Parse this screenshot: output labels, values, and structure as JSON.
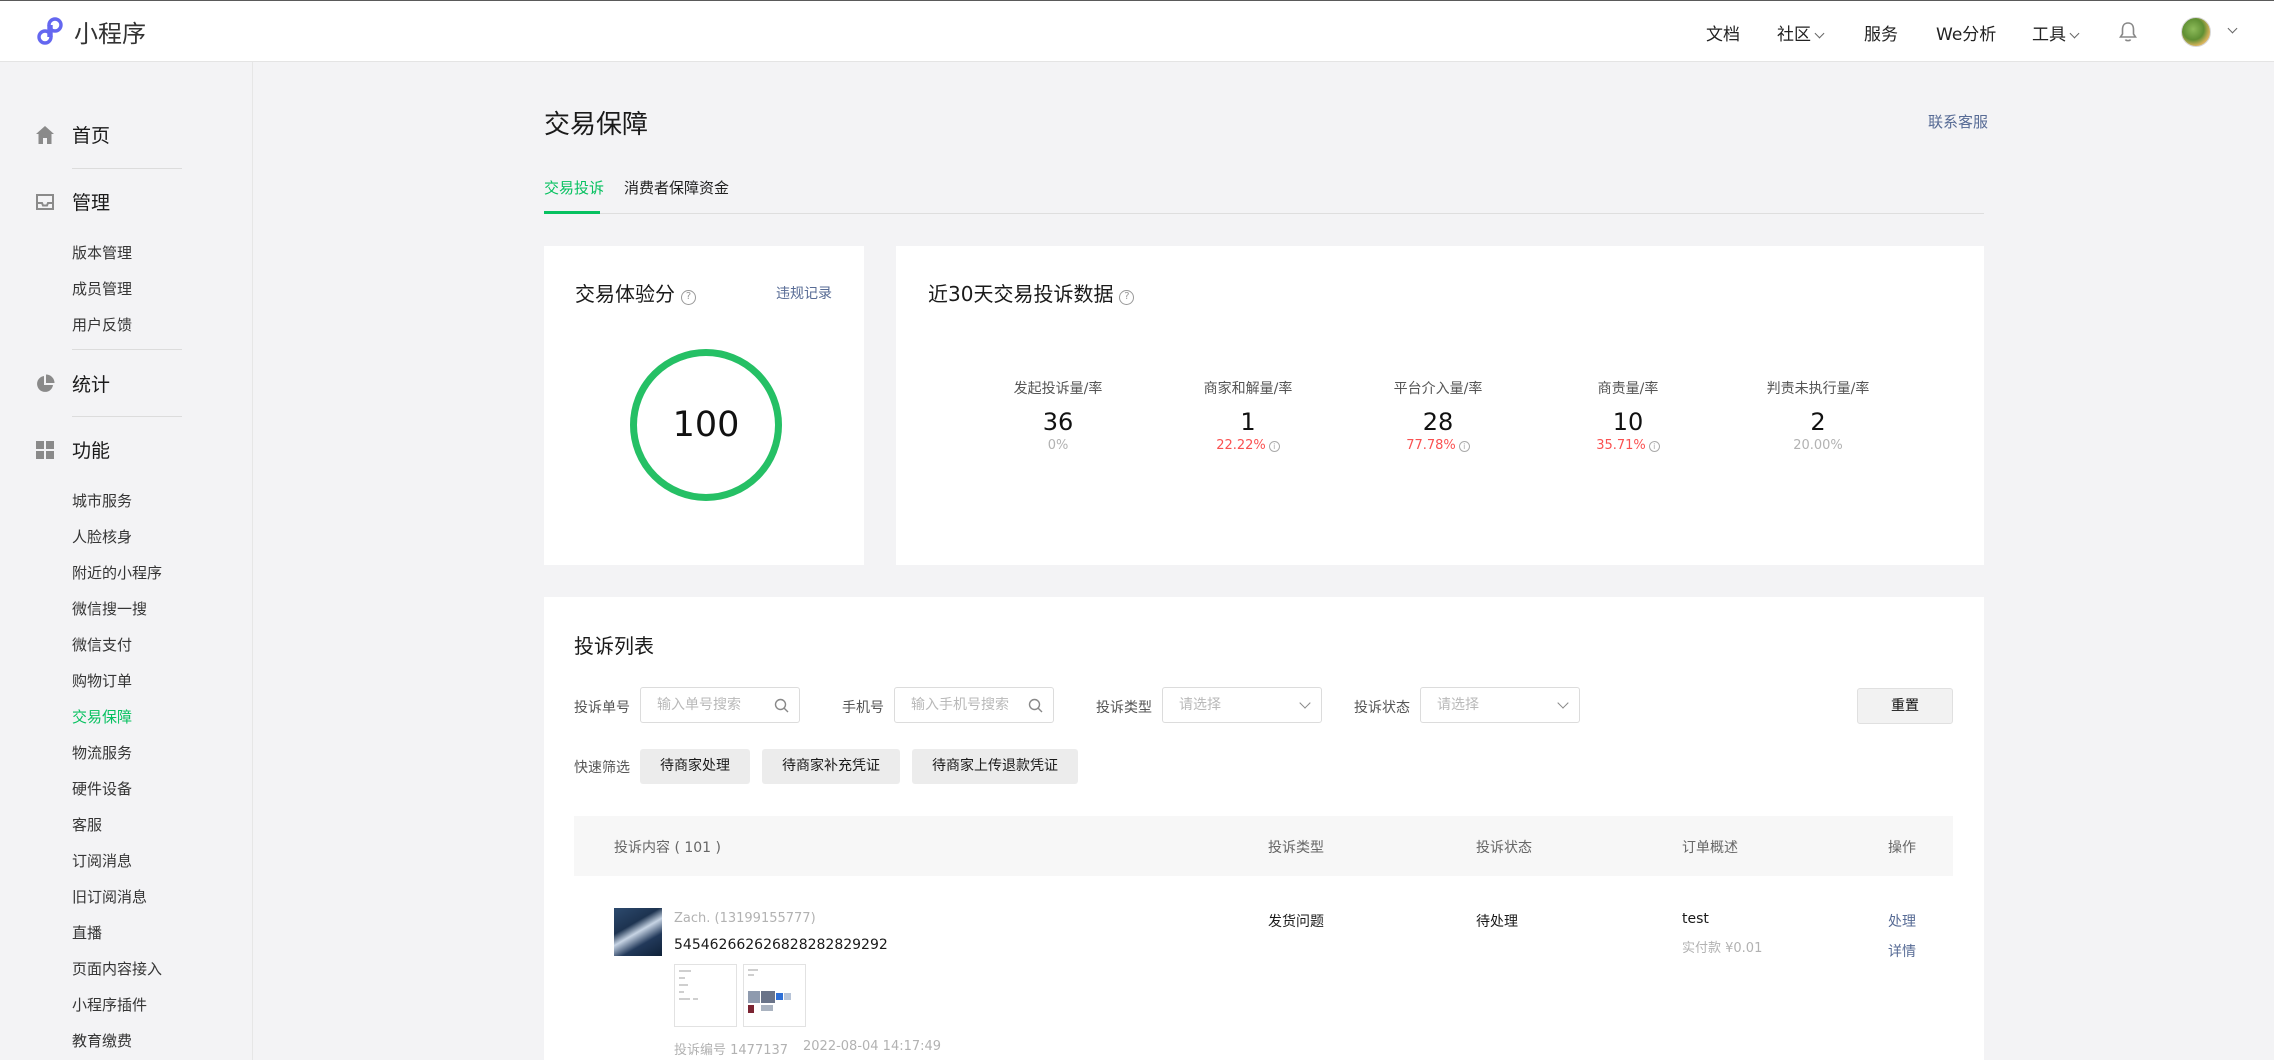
{
  "brand": {
    "name": "小程序"
  },
  "topnav": {
    "docs": "文档",
    "community": "社区",
    "service": "服务",
    "analytics": "We分析",
    "tools": "工具"
  },
  "sidebar": {
    "home": "首页",
    "manage": "管理",
    "manage_items": [
      "版本管理",
      "成员管理",
      "用户反馈"
    ],
    "stats": "统计",
    "features": "功能",
    "feature_items": [
      "城市服务",
      "人脸核身",
      "附近的小程序",
      "微信搜一搜",
      "微信支付",
      "购物订单",
      "交易保障",
      "物流服务",
      "硬件设备",
      "客服",
      "订阅消息",
      "旧订阅消息",
      "直播",
      "页面内容接入",
      "小程序插件",
      "教育缴费"
    ],
    "active_item": "交易保障"
  },
  "page": {
    "title": "交易保障",
    "contact": "联系客服",
    "tabs": [
      "交易投诉",
      "消费者保障资金"
    ],
    "active_tab": "交易投诉"
  },
  "score_card": {
    "title": "交易体验分",
    "violation_link": "违规记录",
    "score": "100",
    "ring_fill_fraction": 1.0,
    "ring_color": "#25c065"
  },
  "stats_card": {
    "title": "近30天交易投诉数据",
    "items": [
      {
        "label": "发起投诉量/率",
        "value": "36",
        "rate": "0%",
        "rate_color": "#b2b2b2",
        "info": false
      },
      {
        "label": "商家和解量/率",
        "value": "1",
        "rate": "22.22%",
        "rate_color": "#fa5151",
        "info": true
      },
      {
        "label": "平台介入量/率",
        "value": "28",
        "rate": "77.78%",
        "rate_color": "#fa5151",
        "info": true
      },
      {
        "label": "商责量/率",
        "value": "10",
        "rate": "35.71%",
        "rate_color": "#fa5151",
        "info": true
      },
      {
        "label": "判责未执行量/率",
        "value": "2",
        "rate": "20.00%",
        "rate_color": "#b2b2b2",
        "info": false
      }
    ]
  },
  "complaints": {
    "title": "投诉列表",
    "filters": {
      "order_label": "投诉单号",
      "order_placeholder": "输入单号搜索",
      "phone_label": "手机号",
      "phone_placeholder": "输入手机号搜索",
      "type_label": "投诉类型",
      "type_placeholder": "请选择",
      "status_label": "投诉状态",
      "status_placeholder": "请选择",
      "reset": "重置"
    },
    "quick_filter_label": "快速筛选",
    "quick_filters": [
      "待商家处理",
      "待商家补充凭证",
      "待商家上传退款凭证"
    ],
    "table": {
      "columns": [
        "投诉内容 ( 101 )",
        "投诉类型",
        "投诉状态",
        "订单概述",
        "操作"
      ],
      "rows": [
        {
          "user": "Zach. (13199155777)",
          "order_no": "545462662626828282829292",
          "type": "发货问题",
          "status": "待处理",
          "summary": "test",
          "paid": "实付款 ¥0.01",
          "actions": [
            "处理",
            "详情"
          ],
          "complaint_id": "投诉编号 1477137",
          "time": "2022-08-04 14:17:49"
        }
      ]
    }
  },
  "colors": {
    "accent": "#07c160",
    "link": "#576b95",
    "danger": "#fa5151"
  }
}
